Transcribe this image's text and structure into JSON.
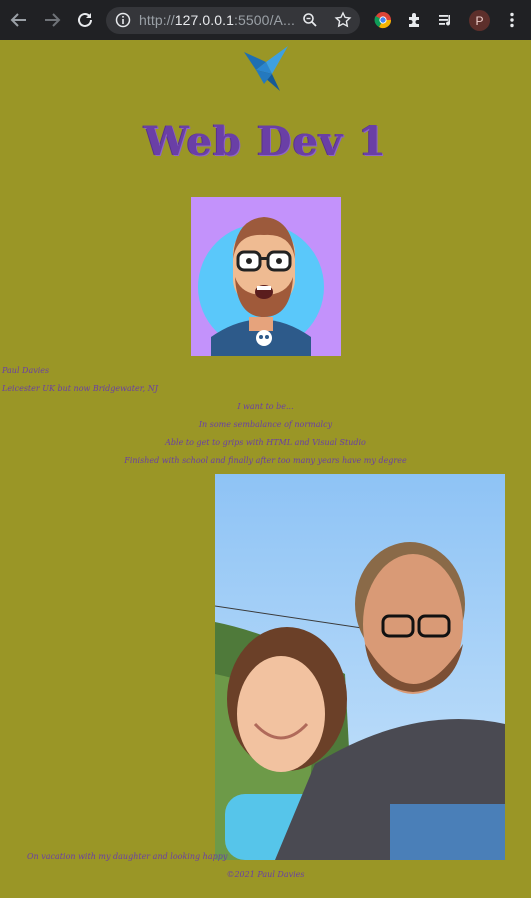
{
  "browser": {
    "url_prefix": "http://",
    "url_host": "127.0.0.1",
    "url_rest": ":5500/A...",
    "profile_initial": "P"
  },
  "page": {
    "title": "Web Dev 1",
    "name": "Paul Davies",
    "location": "Leicester UK but now Bridgewater, NJ",
    "goals_heading": "I want to be...",
    "goals": [
      "In some sembalance of normalcy",
      "Able to get to grips with HTML and Visual Studio",
      "Finished with school and finally after too many years have my degree"
    ],
    "photo_caption": "On vacation with my daughter and looking happy",
    "footer": "©2021 Paul Davies"
  },
  "colors": {
    "background": "#9a9626",
    "accent": "#6a3fa6",
    "chrome": "#202124"
  }
}
